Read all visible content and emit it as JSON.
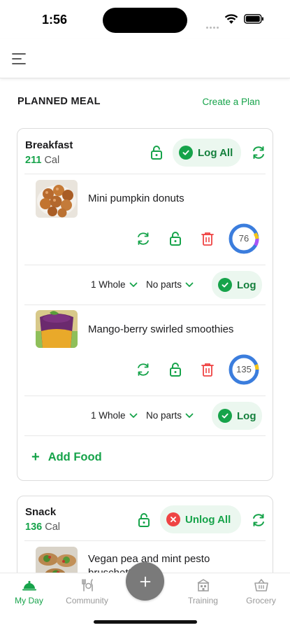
{
  "status": {
    "time": "1:56"
  },
  "header": {
    "menu_icon": "menu-icon"
  },
  "section": {
    "title": "PLANNED MEAL",
    "create_plan": "Create a Plan"
  },
  "colors": {
    "accent": "#16a34a",
    "accent_bg": "#ebf7ef",
    "danger": "#ef4444",
    "ring_blue": "#3b7ddd",
    "ring_yellow": "#f5c518",
    "ring_purple": "#a855f7"
  },
  "breakfast": {
    "name": "Breakfast",
    "cal_value": "211",
    "cal_unit": "Cal",
    "log_all": "Log All",
    "foods": [
      {
        "name": "Mini pumpkin donuts",
        "score": "76",
        "qty": "1 Whole",
        "parts": "No parts",
        "log": "Log"
      },
      {
        "name": "Mango-berry swirled smoothies",
        "score": "135",
        "qty": "1 Whole",
        "parts": "No parts",
        "log": "Log"
      }
    ],
    "add_food": "Add Food"
  },
  "snack": {
    "name": "Snack",
    "cal_value": "136",
    "cal_unit": "Cal",
    "unlog_all": "Unlog All",
    "foods": [
      {
        "name": "Vegan pea and mint pesto bruschetta"
      }
    ]
  },
  "tabs": [
    {
      "label": "My Day",
      "icon": "cloche-icon",
      "active": true
    },
    {
      "label": "Community",
      "icon": "utensils-icon",
      "active": false
    },
    {
      "label": "Training",
      "icon": "building-icon",
      "active": false
    },
    {
      "label": "Grocery",
      "icon": "basket-icon",
      "active": false
    }
  ],
  "fab": {
    "icon": "plus-icon"
  }
}
